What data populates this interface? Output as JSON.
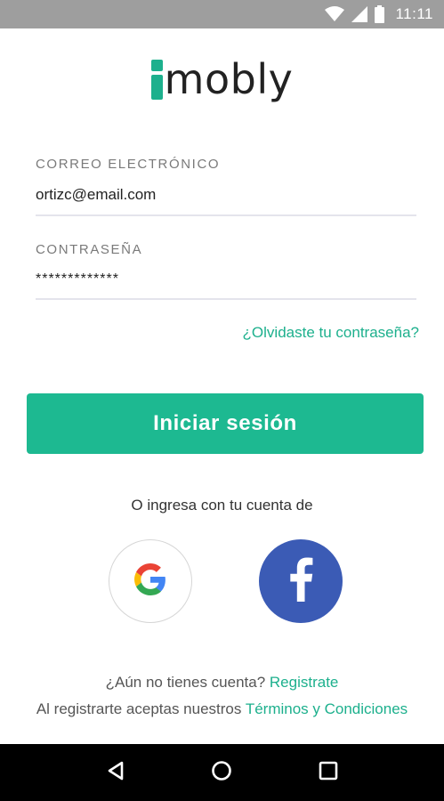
{
  "status_bar": {
    "time": "11:11",
    "icons": [
      "wifi-icon",
      "cell-signal-icon",
      "battery-icon"
    ]
  },
  "logo": {
    "text": "mobly",
    "accent_color": "#1db08d"
  },
  "form": {
    "email_label": "CORREO ELECTRÓNICO",
    "email_value": "ortizc@email.com",
    "password_label": "CONTRASEÑA",
    "password_value": "*************",
    "forgot_password": "¿Olvidaste tu contraseña?",
    "login_button": "Iniciar sesión"
  },
  "social": {
    "caption": "O ingresa con tu cuenta de",
    "providers": [
      "google-icon",
      "facebook-icon"
    ]
  },
  "footer": {
    "no_account_text": "¿Aún no tienes cuenta?",
    "register_link": "Registrate",
    "terms_prefix": "Al registrarte aceptas nuestros",
    "terms_link": "Términos y Condiciones"
  },
  "nav_bar": {
    "buttons": [
      "back-icon",
      "home-icon",
      "recents-icon"
    ]
  },
  "colors": {
    "primary": "#1db991",
    "link": "#1db08d",
    "facebook": "#3b5bb5",
    "status_bar": "#9e9e9e"
  }
}
